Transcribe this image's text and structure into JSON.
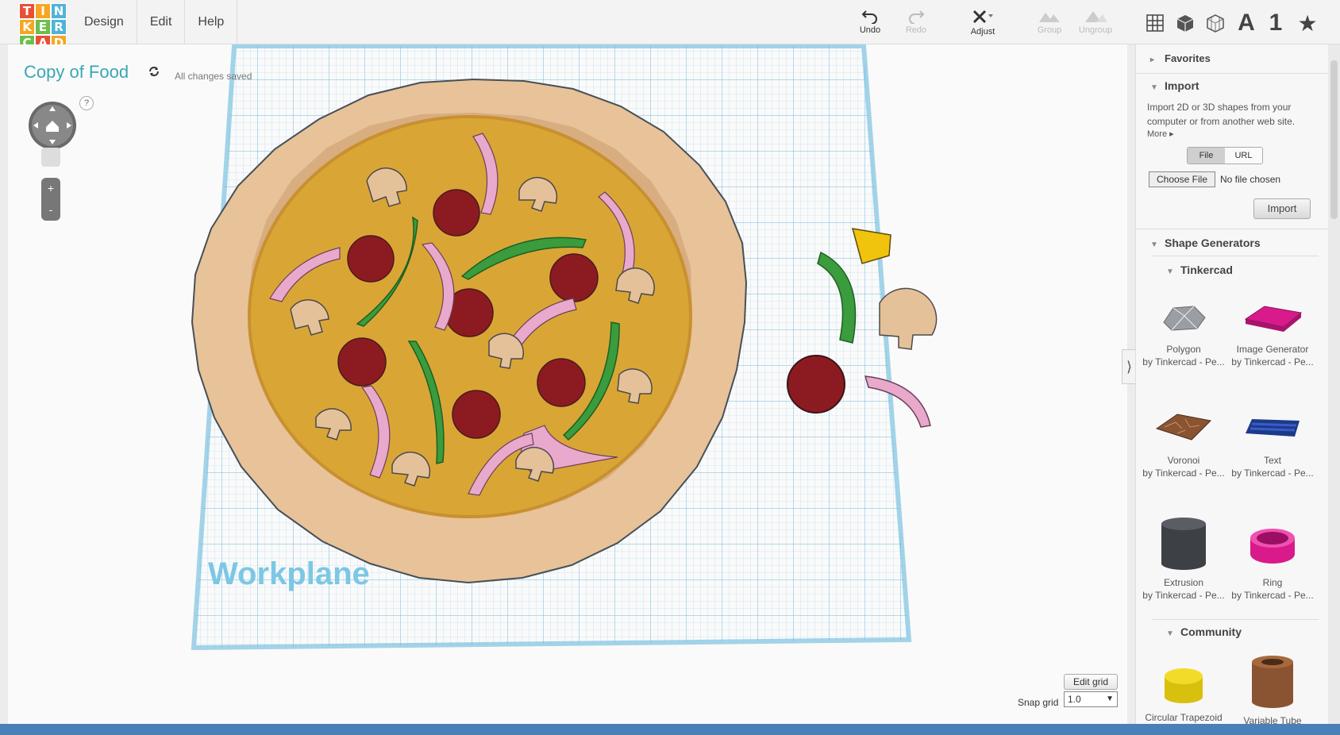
{
  "logo": {
    "letters": [
      "T",
      "I",
      "N",
      "K",
      "E",
      "R",
      "C",
      "A",
      "D"
    ],
    "colors": [
      "#e94f37",
      "#f6a623",
      "#4fb3d9",
      "#f6a623",
      "#6cbf4b",
      "#4fb3d9",
      "#6cbf4b",
      "#e94f37",
      "#f6a623"
    ]
  },
  "menu": [
    {
      "label": "Design"
    },
    {
      "label": "Edit"
    },
    {
      "label": "Help"
    }
  ],
  "toolbar": {
    "undo": {
      "label": "Undo",
      "icon": "undo-icon"
    },
    "redo": {
      "label": "Redo",
      "icon": "redo-icon"
    },
    "adjust": {
      "label": "Adjust",
      "icon": "adjust-icon"
    },
    "group": {
      "label": "Group",
      "icon": "group-icon"
    },
    "ungroup": {
      "label": "Ungroup",
      "icon": "ungroup-icon"
    }
  },
  "view_icons": {
    "text_label": "A",
    "number_label": "1"
  },
  "design": {
    "title": "Copy of Food",
    "save_status": "All changes saved"
  },
  "nav": {
    "help": "?",
    "zoom_in": "+",
    "zoom_out": "-"
  },
  "workplane": {
    "label": "Workplane"
  },
  "grid": {
    "edit_label": "Edit grid",
    "snap_label": "Snap grid",
    "snap_value": "1.0"
  },
  "sidebar": {
    "favorites": {
      "title": "Favorites"
    },
    "import": {
      "title": "Import",
      "description": "Import 2D or 3D shapes from your computer or from another web site.",
      "more": "More ▸",
      "tabs": [
        {
          "label": "File"
        },
        {
          "label": "URL"
        }
      ],
      "choose_file": "Choose File",
      "no_file": "No file chosen",
      "button": "Import"
    },
    "shape_generators": {
      "title": "Shape Generators"
    },
    "tinkercad": {
      "title": "Tinkercad"
    },
    "shapes": [
      {
        "name": "Polygon",
        "by": "by Tinkercad - Pe..."
      },
      {
        "name": "Image Generator",
        "by": "by Tinkercad - Pe..."
      },
      {
        "name": "Voronoi",
        "by": "by Tinkercad - Pe..."
      },
      {
        "name": "Text",
        "by": "by Tinkercad - Pe..."
      },
      {
        "name": "Extrusion",
        "by": "by Tinkercad - Pe..."
      },
      {
        "name": "Ring",
        "by": "by Tinkercad - Pe..."
      }
    ],
    "community": {
      "title": "Community"
    },
    "community_shapes": [
      {
        "name": "Circular Trapezoid"
      },
      {
        "name": "Variable Tube"
      }
    ]
  }
}
